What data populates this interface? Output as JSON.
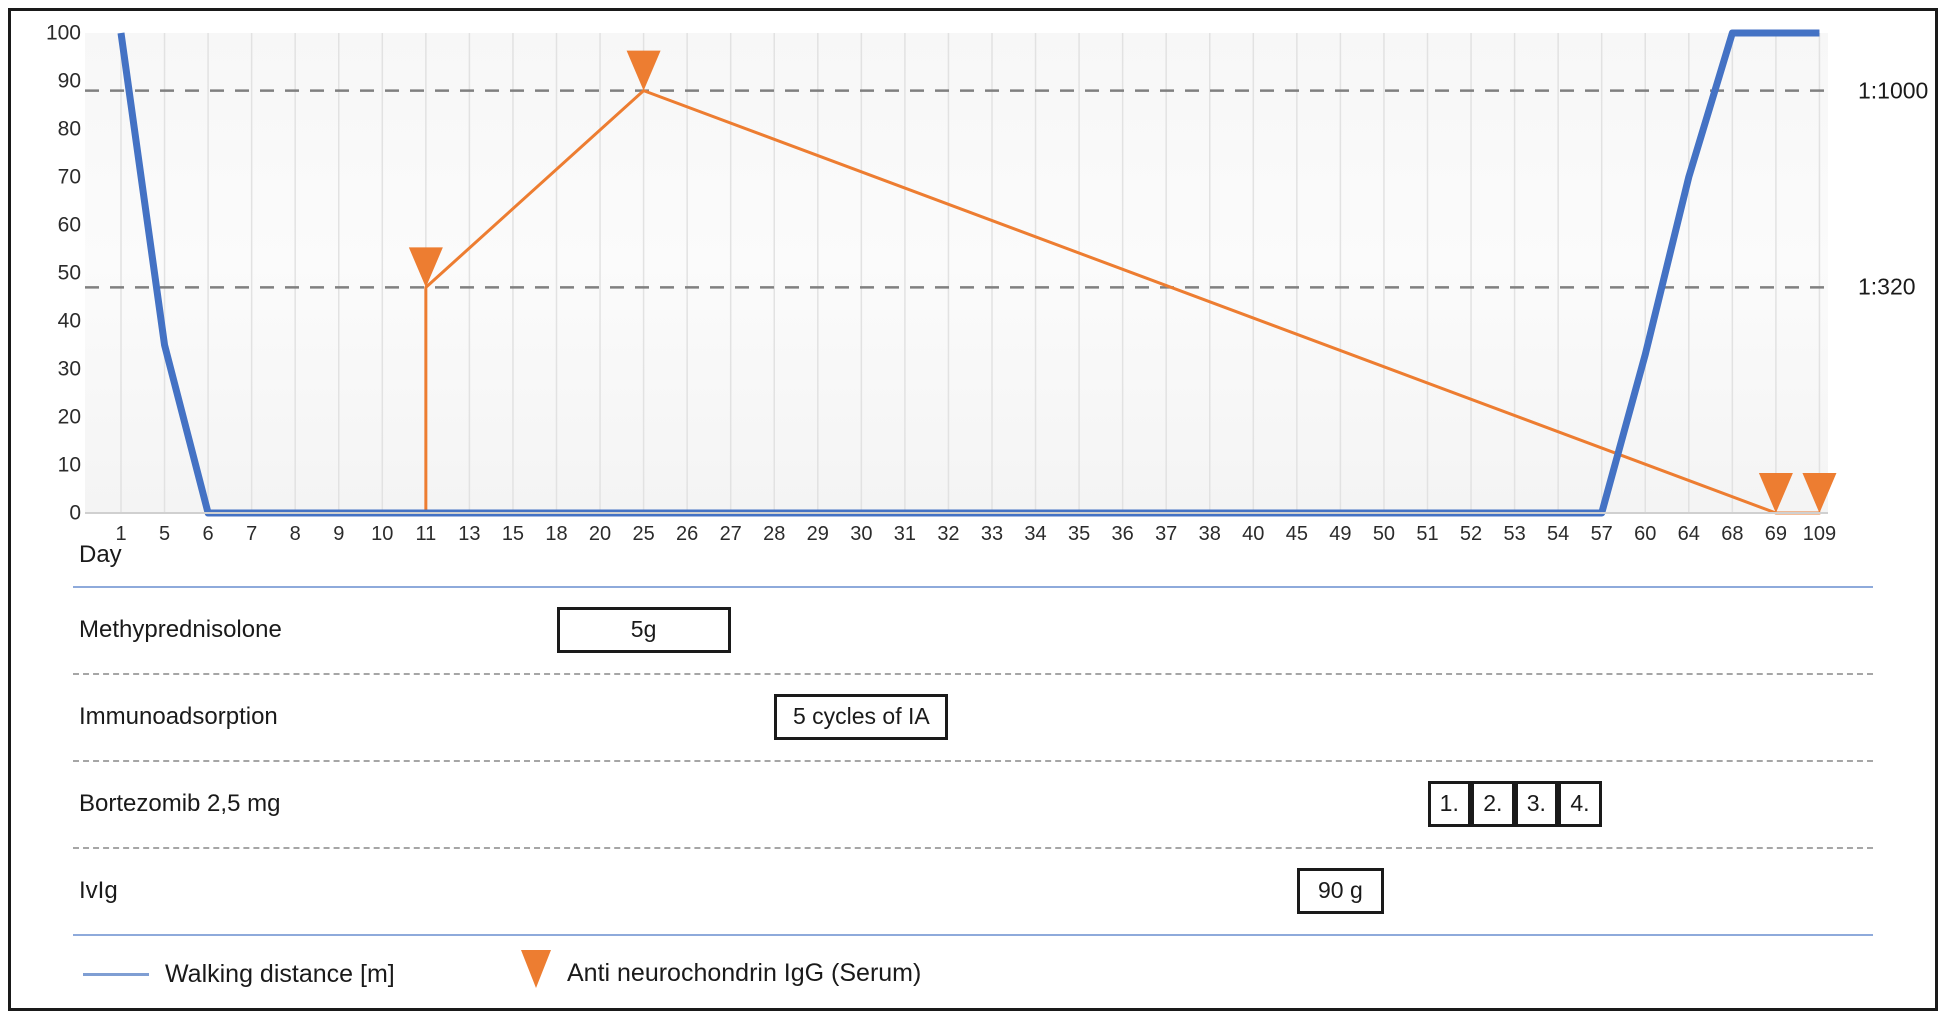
{
  "chart_data": {
    "type": "line",
    "title": "",
    "xlabel": "Day",
    "ylabel": "",
    "ylim": [
      0,
      100
    ],
    "yticks": [
      0,
      10,
      20,
      30,
      40,
      50,
      60,
      70,
      80,
      90,
      100
    ],
    "grid": true,
    "legend_position": "bottom-left",
    "categories": [
      1,
      5,
      6,
      7,
      8,
      9,
      10,
      11,
      13,
      15,
      18,
      20,
      25,
      26,
      27,
      28,
      29,
      30,
      31,
      32,
      33,
      34,
      35,
      36,
      37,
      38,
      40,
      45,
      49,
      50,
      51,
      52,
      53,
      54,
      57,
      60,
      64,
      68,
      69,
      109
    ],
    "series": [
      {
        "name": "Walking distance [m]",
        "color": "#4472C4",
        "type": "line",
        "points": [
          {
            "day": 1,
            "value": 100
          },
          {
            "day": 5,
            "value": 35
          },
          {
            "day": 6,
            "value": 0
          },
          {
            "day": 7,
            "value": 0
          },
          {
            "day": 8,
            "value": 0
          },
          {
            "day": 9,
            "value": 0
          },
          {
            "day": 10,
            "value": 0
          },
          {
            "day": 11,
            "value": 0
          },
          {
            "day": 13,
            "value": 0
          },
          {
            "day": 15,
            "value": 0
          },
          {
            "day": 18,
            "value": 0
          },
          {
            "day": 20,
            "value": 0
          },
          {
            "day": 25,
            "value": 0
          },
          {
            "day": 26,
            "value": 0
          },
          {
            "day": 27,
            "value": 0
          },
          {
            "day": 28,
            "value": 0
          },
          {
            "day": 29,
            "value": 0
          },
          {
            "day": 30,
            "value": 0
          },
          {
            "day": 31,
            "value": 0
          },
          {
            "day": 32,
            "value": 0
          },
          {
            "day": 33,
            "value": 0
          },
          {
            "day": 34,
            "value": 0
          },
          {
            "day": 35,
            "value": 0
          },
          {
            "day": 36,
            "value": 0
          },
          {
            "day": 37,
            "value": 0
          },
          {
            "day": 38,
            "value": 0
          },
          {
            "day": 40,
            "value": 0
          },
          {
            "day": 45,
            "value": 0
          },
          {
            "day": 49,
            "value": 0
          },
          {
            "day": 50,
            "value": 0
          },
          {
            "day": 51,
            "value": 0
          },
          {
            "day": 52,
            "value": 0
          },
          {
            "day": 53,
            "value": 0
          },
          {
            "day": 54,
            "value": 0
          },
          {
            "day": 57,
            "value": 0
          },
          {
            "day": 60,
            "value": 33
          },
          {
            "day": 64,
            "value": 70
          },
          {
            "day": 68,
            "value": 100
          },
          {
            "day": 69,
            "value": 100
          },
          {
            "day": 109,
            "value": 100
          }
        ]
      },
      {
        "name": "Anti neurochondrin IgG (Serum)",
        "color": "#ED7D31",
        "type": "line-with-markers",
        "points": [
          {
            "day": 11,
            "value": 0
          },
          {
            "day": 11,
            "value": 47
          },
          {
            "day": 25,
            "value": 88
          },
          {
            "day": 69,
            "value": 0
          },
          {
            "day": 109,
            "value": 0
          }
        ],
        "markers": [
          {
            "day": 11,
            "value": 47
          },
          {
            "day": 25,
            "value": 88
          },
          {
            "day": 69,
            "value": 0
          },
          {
            "day": 109,
            "value": 0
          }
        ]
      }
    ],
    "reference_lines": [
      {
        "label": "1:1000",
        "value": 88,
        "style": "dashed",
        "color": "#808080"
      },
      {
        "label": "1:320",
        "value": 47,
        "style": "dashed",
        "color": "#808080"
      }
    ]
  },
  "axis": {
    "day_label": "Day",
    "yticks": [
      "100",
      "90",
      "80",
      "70",
      "60",
      "50",
      "40",
      "30",
      "20",
      "10",
      "0"
    ],
    "xticks": [
      "1",
      "5",
      "6",
      "7",
      "8",
      "9",
      "10",
      "11",
      "13",
      "15",
      "18",
      "20",
      "25",
      "26",
      "27",
      "28",
      "29",
      "30",
      "31",
      "32",
      "33",
      "34",
      "35",
      "36",
      "37",
      "38",
      "40",
      "45",
      "49",
      "50",
      "51",
      "52",
      "53",
      "54",
      "57",
      "60",
      "64",
      "68",
      "69",
      "109"
    ],
    "reference_labels": [
      "1:1000",
      "1:320"
    ]
  },
  "timeline": {
    "rows": [
      {
        "label": "Methyprednisolone",
        "boxes": [
          {
            "text": "5g",
            "start_day": 18,
            "end_day": 27
          }
        ]
      },
      {
        "label": "Immunoadsorption",
        "boxes": [
          {
            "text": "5 cycles of IA",
            "start_day": 28,
            "end_day": 32
          }
        ]
      },
      {
        "label": "Bortezomib 2,5 mg",
        "boxes": [
          {
            "text": "1.",
            "start_day": 51,
            "end_day": 52
          },
          {
            "text": "2.",
            "start_day": 52,
            "end_day": 53
          },
          {
            "text": "3.",
            "start_day": 53,
            "end_day": 54
          },
          {
            "text": "4.",
            "start_day": 54,
            "end_day": 57
          }
        ]
      },
      {
        "label": "IvIg",
        "boxes": [
          {
            "text": "90 g",
            "start_day": 45,
            "end_day": 50
          }
        ]
      }
    ]
  },
  "legend": {
    "items": [
      {
        "icon": "line-swatch",
        "label": "Walking distance [m]",
        "color": "#7f9ed3"
      },
      {
        "icon": "triangle-marker",
        "label": "Anti neurochondrin IgG (Serum)",
        "color": "#ED7D31"
      }
    ]
  }
}
